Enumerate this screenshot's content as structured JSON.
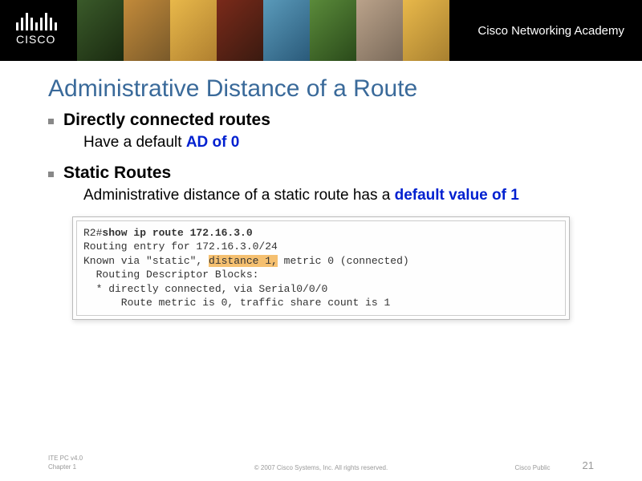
{
  "header": {
    "logo_text": "CISCO",
    "academy": "Cisco Networking Academy"
  },
  "slide": {
    "title": "Administrative Distance of a Route",
    "bullets": [
      {
        "heading": "Directly connected routes",
        "sub_pre": "Have a default ",
        "sub_highlight": "AD of 0",
        "sub_post": ""
      },
      {
        "heading": "Static Routes",
        "sub_pre": "Administrative distance of a static route has a ",
        "sub_highlight": "default value of 1",
        "sub_post": ""
      }
    ],
    "code": {
      "line1_prompt": "R2#",
      "line1_cmd": "show ip route 172.16.3.0",
      "line2": "Routing entry for 172.16.3.0/24",
      "line3_pre": "Known via \"static\", ",
      "line3_hl": "distance 1,",
      "line3_post": " metric 0 (connected)",
      "line4": "  Routing Descriptor Blocks:",
      "line5": "  * directly connected, via Serial0/0/0",
      "line6": "      Route metric is 0, traffic share count is 1"
    }
  },
  "footer": {
    "left_line1": "ITE PC v4.0",
    "left_line2": "Chapter 1",
    "center": "© 2007 Cisco Systems, Inc. All rights reserved.",
    "right_label": "Cisco Public",
    "page": "21"
  }
}
